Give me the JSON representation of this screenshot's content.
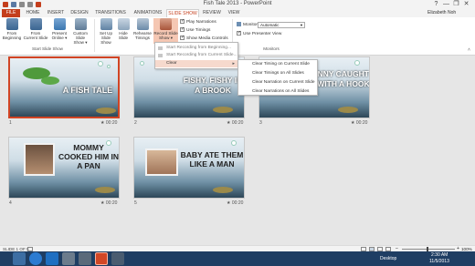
{
  "window": {
    "title": "Fish Tale 2013 - PowerPoint",
    "controls": [
      "?",
      "—",
      "❐",
      "✕"
    ]
  },
  "tabs": [
    "FILE",
    "HOME",
    "INSERT",
    "DESIGN",
    "TRANSITIONS",
    "ANIMATIONS",
    "SLIDE SHOW",
    "REVIEW",
    "VIEW"
  ],
  "active_tab": "SLIDE SHOW",
  "user": "Elizabeth Noh",
  "ribbon": {
    "start_group": {
      "label": "Start Slide Show",
      "from_beginning": [
        "From",
        "Beginning"
      ],
      "from_current": [
        "From",
        "Current Slide"
      ],
      "present_online": [
        "Present",
        "Online ▾"
      ],
      "custom_show": [
        "Custom Slide",
        "Show ▾"
      ]
    },
    "setup": {
      "set_up": [
        "Set Up",
        "Slide Show"
      ],
      "hide_slide": [
        "Hide",
        "Slide"
      ],
      "rehearse": [
        "Rehearse",
        "Timings"
      ],
      "record": [
        "Record Slide",
        "Show ▾"
      ],
      "record_short": "Record",
      "record_slide": "Slide",
      "from_slide": [
        "Fro",
        "Slid"
      ],
      "checks": [
        {
          "label": "Play Narrations",
          "checked": true
        },
        {
          "label": "Use Timings",
          "checked": true
        },
        {
          "label": "Show Media Controls",
          "checked": true
        }
      ]
    },
    "monitors": {
      "label": "Monitors",
      "monitor_label": "Monitor:",
      "monitor_value": "Automatic",
      "presenter_view": "Use Presenter View",
      "presenter_checked": true
    }
  },
  "record_menu": {
    "items": [
      {
        "label": "Start Recording from Beginning...",
        "enabled": false
      },
      {
        "label": "Start Recording from Current Slide...",
        "enabled": false
      },
      {
        "label": "Clear",
        "has_submenu": true
      }
    ]
  },
  "clear_submenu": {
    "items": [
      "Clear Timing on Current Slide",
      "Clear Timings on All Slides",
      "Clear Narration on Current Slide",
      "Clear Narrations on All Slides"
    ]
  },
  "slides": [
    {
      "number": "1",
      "duration": "00:20",
      "text": "A FISH TALE"
    },
    {
      "number": "2",
      "duration": "00:20",
      "text": "FISHY, FISHY IN A BROOK"
    },
    {
      "number": "3",
      "duration": "00:20",
      "text": "JOHNNY CAUGHT HIM WITH A HOOK"
    },
    {
      "number": "4",
      "duration": "00:20",
      "text": "MOMMY COOKED HIM IN A PAN"
    },
    {
      "number": "5",
      "duration": "00:20",
      "text": "BABY ATE THEM LIKE A MAN"
    }
  ],
  "status": {
    "slide_info": "SLIDE 1 OF 5",
    "zoom": "100%"
  },
  "taskbar": {
    "desktop": "Desktop",
    "time": "2:30 AM",
    "date": "11/5/2013"
  },
  "colors": {
    "accent": "#c43e1c",
    "taskbar": "#1f3e63",
    "menu_hover": "#f6d9cd"
  }
}
